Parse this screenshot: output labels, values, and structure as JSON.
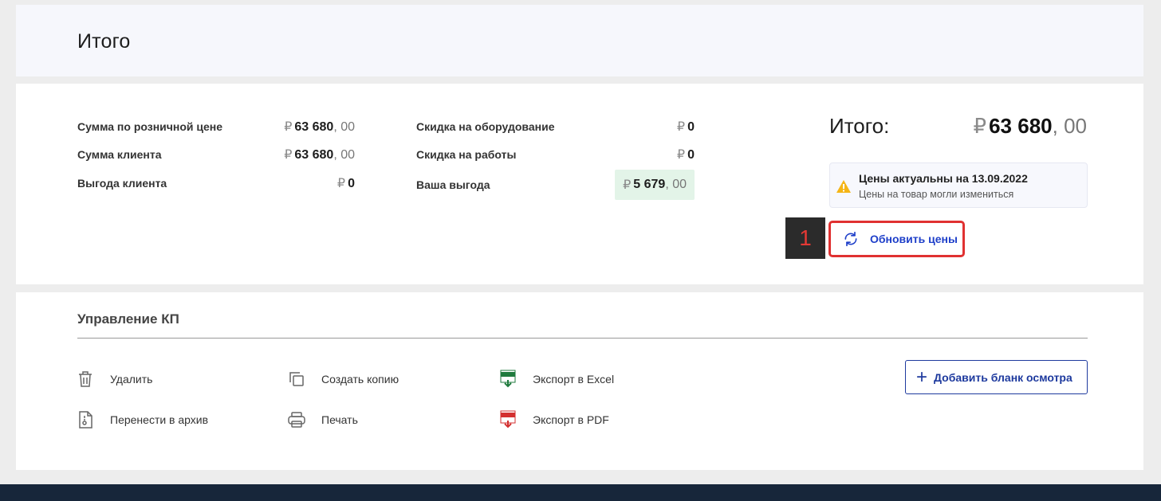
{
  "header": {
    "title": "Итого"
  },
  "totals": {
    "currency": "₽",
    "left": [
      {
        "label": "Сумма по розничной цене",
        "int": "63 680",
        "dec": ", 00"
      },
      {
        "label": "Сумма клиента",
        "int": "63 680",
        "dec": ", 00"
      },
      {
        "label": "Выгода клиента",
        "int": "0",
        "dec": ""
      }
    ],
    "right": [
      {
        "label": "Скидка на оборудование",
        "int": "0",
        "dec": ""
      },
      {
        "label": "Скидка на работы",
        "int": "0",
        "dec": ""
      },
      {
        "label": "Ваша выгода",
        "int": "5 679",
        "dec": ", 00"
      }
    ],
    "grand": {
      "label": "Итого:",
      "int": "63 680",
      "dec": ", 00"
    },
    "notice": {
      "title": "Цены актуальны на 13.09.2022",
      "subtitle": "Цены на товар могли измениться"
    },
    "step_badge": "1",
    "refresh_label": "Обновить цены"
  },
  "manage": {
    "title": "Управление КП",
    "actions": {
      "delete": "Удалить",
      "archive": "Перенести в архив",
      "copy": "Создать копию",
      "print": "Печать",
      "excel": "Экспорт в Excel",
      "pdf": "Экспорт в PDF"
    },
    "add_label": "Добавить бланк осмотра"
  },
  "colors": {
    "accent": "#1e3fc9",
    "highlight": "#e3f4e8",
    "warning": "#f5b516",
    "outline": "#e03131",
    "footer": "#17263a"
  }
}
